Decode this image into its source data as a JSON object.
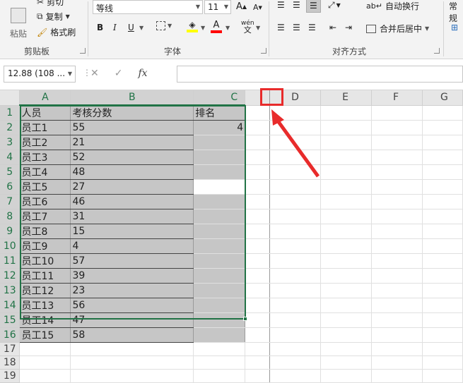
{
  "ribbon": {
    "clipboard": {
      "paste_label": "粘贴",
      "cut_label": "剪切",
      "copy_label": "复制",
      "format_painter_label": "格式刷",
      "group_label": "剪贴板"
    },
    "font": {
      "font_name": "等线",
      "font_size": "11",
      "bold": "B",
      "italic": "I",
      "underline": "U",
      "group_label": "字体",
      "wen_label": "wén"
    },
    "alignment": {
      "wrap_text_label": "自动换行",
      "merge_center_label": "合并后居中",
      "group_label": "对齐方式"
    },
    "number": {
      "format_label": "常规"
    },
    "colors": {
      "highlight": "#ffff00",
      "font_color": "#ff0000",
      "accent": "#217346"
    }
  },
  "formula_bar": {
    "name_box": "12.88 (108 ...",
    "cancel": "✕",
    "enter": "✓",
    "fx": "fx",
    "value": ""
  },
  "sheet": {
    "columns": [
      "A",
      "B",
      "C",
      "D",
      "E",
      "F",
      "G"
    ],
    "header": {
      "a": "人员",
      "b": "考核分数",
      "c": "排名"
    },
    "rows": [
      {
        "n": "2",
        "a": "员工1",
        "b": "55",
        "c": "4"
      },
      {
        "n": "3",
        "a": "员工2",
        "b": "21",
        "c": ""
      },
      {
        "n": "4",
        "a": "员工3",
        "b": "52",
        "c": ""
      },
      {
        "n": "5",
        "a": "员工4",
        "b": "48",
        "c": ""
      },
      {
        "n": "6",
        "a": "员工5",
        "b": "27",
        "c": ""
      },
      {
        "n": "7",
        "a": "员工6",
        "b": "46",
        "c": ""
      },
      {
        "n": "8",
        "a": "员工7",
        "b": "31",
        "c": ""
      },
      {
        "n": "9",
        "a": "员工8",
        "b": "15",
        "c": ""
      },
      {
        "n": "10",
        "a": "员工9",
        "b": "4",
        "c": ""
      },
      {
        "n": "11",
        "a": "员工10",
        "b": "57",
        "c": ""
      },
      {
        "n": "12",
        "a": "员工11",
        "b": "39",
        "c": ""
      },
      {
        "n": "13",
        "a": "员工12",
        "b": "23",
        "c": ""
      },
      {
        "n": "14",
        "a": "员工13",
        "b": "56",
        "c": ""
      },
      {
        "n": "15",
        "a": "员工14",
        "b": "47",
        "c": ""
      },
      {
        "n": "16",
        "a": "员工15",
        "b": "58",
        "c": ""
      }
    ],
    "extra_rows": [
      "17",
      "18",
      "19"
    ],
    "header_row_number": "1"
  }
}
